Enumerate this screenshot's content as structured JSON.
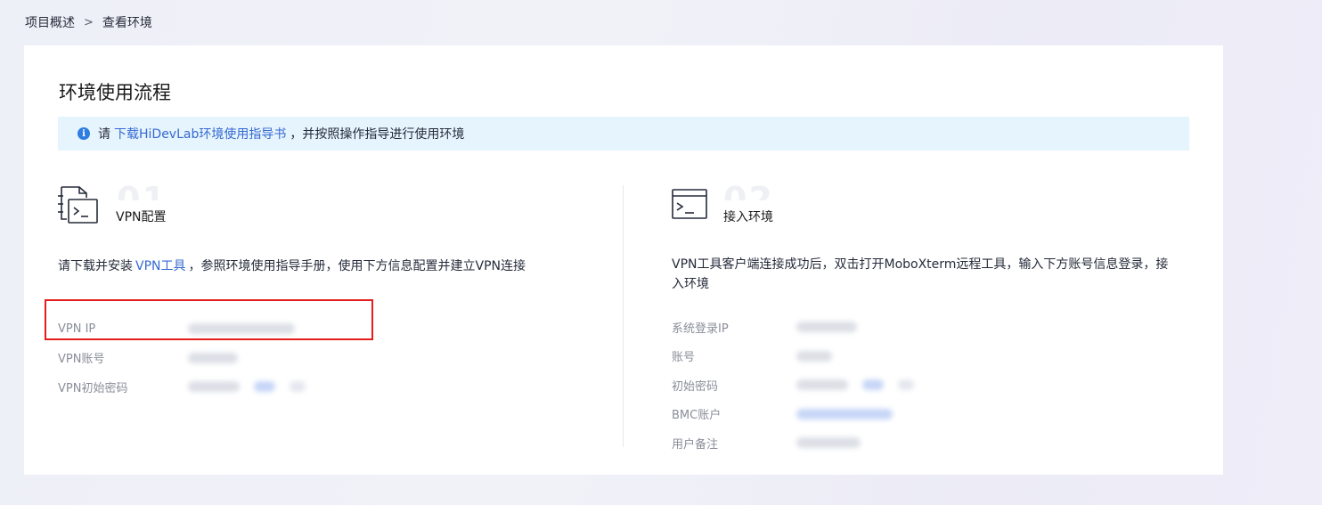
{
  "breadcrumb": {
    "parent": "项目概述",
    "separator": ">",
    "current": "查看环境"
  },
  "card": {
    "title": "环境使用流程"
  },
  "info": {
    "prefix": "请",
    "link": "下载HiDevLab环境使用指导书",
    "suffix": "，并按照操作指导进行使用环境"
  },
  "step1": {
    "number": "01",
    "name": "VPN配置",
    "desc_prefix": "请下载并安装",
    "desc_link": "VPN工具",
    "desc_suffix": "，参照环境使用指导手册，使用下方信息配置并建立VPN连接",
    "fields": [
      {
        "label": "VPN IP"
      },
      {
        "label": "VPN账号"
      },
      {
        "label": "VPN初始密码"
      }
    ]
  },
  "step2": {
    "number": "02",
    "name": "接入环境",
    "desc": "VPN工具客户端连接成功后，双击打开MoboXterm远程工具，输入下方账号信息登录，接入环境",
    "fields": [
      {
        "label": "系统登录IP"
      },
      {
        "label": "账号"
      },
      {
        "label": "初始密码"
      },
      {
        "label": "BMC账户"
      },
      {
        "label": "用户备注"
      }
    ]
  },
  "colors": {
    "link": "#3569d1",
    "info_background": "#e6f4fd",
    "info_icon": "#2e7de0",
    "highlight": "#e41e1e"
  },
  "icons": [
    "info-icon",
    "terminal-document-icon",
    "terminal-window-icon"
  ]
}
